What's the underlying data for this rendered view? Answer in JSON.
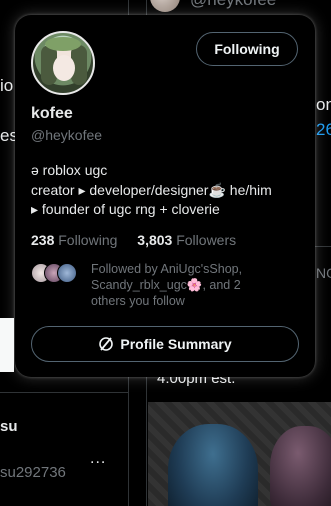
{
  "background": {
    "top_handle": "@heykofee",
    "left_fragment_1": "io",
    "left_fragment_2": "es",
    "right_fragment_1": "on",
    "right_fragment_2": "26",
    "right_fragment_3": "NG",
    "time_text": "4:00pm est.",
    "user_name_fragment": "su",
    "user_handle_fragment": "su292736",
    "more_dots": "..."
  },
  "card": {
    "follow_button": "Following",
    "name": "kofee",
    "handle": "@heykofee",
    "bio_line1": "ə roblox ugc",
    "bio_line2": "creator ▸ developer/designer☕ he/him",
    "bio_line3": " ▸ founder of ugc rng + cloverie",
    "following_count": "238",
    "following_label": "Following",
    "followers_count": "3,803",
    "followers_label": "Followers",
    "followed_by_text": "Followed by AniUgc'sShop, Scandy_rblx_ugc🌸, and 2 others you follow",
    "summary_button": "Profile Summary"
  },
  "colors": {
    "background": "#000000",
    "text": "#e7e9ea",
    "secondary_text": "#71767b",
    "border": "#536471",
    "link": "#1d9bf0"
  }
}
